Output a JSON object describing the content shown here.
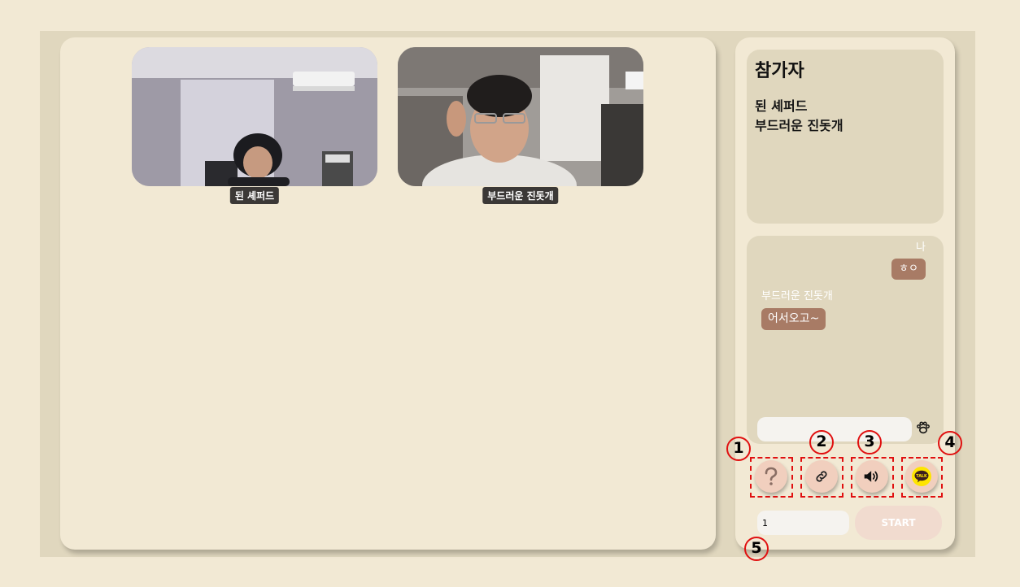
{
  "videos": [
    {
      "name": "된 셰퍼드"
    },
    {
      "name": "부드러운 진돗개"
    }
  ],
  "participants": {
    "title": "참가자",
    "list": [
      "된 셰퍼드",
      "부드러운 진돗개"
    ]
  },
  "chat": {
    "messages": [
      {
        "sender": "나",
        "text": "ㅎㅇ"
      },
      {
        "sender": "부드러운 진돗개",
        "text": "어서오고~"
      }
    ],
    "input_value": ""
  },
  "controls": {
    "help_icon": "question-mark-icon",
    "link_icon": "link-icon",
    "sound_icon": "speaker-icon",
    "kakao_icon": "kakao-talk-icon",
    "kakao_label": "TALK"
  },
  "annotations": [
    "1",
    "2",
    "3",
    "4",
    "5"
  ],
  "round_input_value": "1",
  "start_label": "START",
  "colors": {
    "background": "#f2e9d4",
    "panel": "#e0d7be",
    "bubble": "#a87b65",
    "button": "#f1cfbe",
    "highlight": "#e01010",
    "kakao": "#fee500"
  }
}
